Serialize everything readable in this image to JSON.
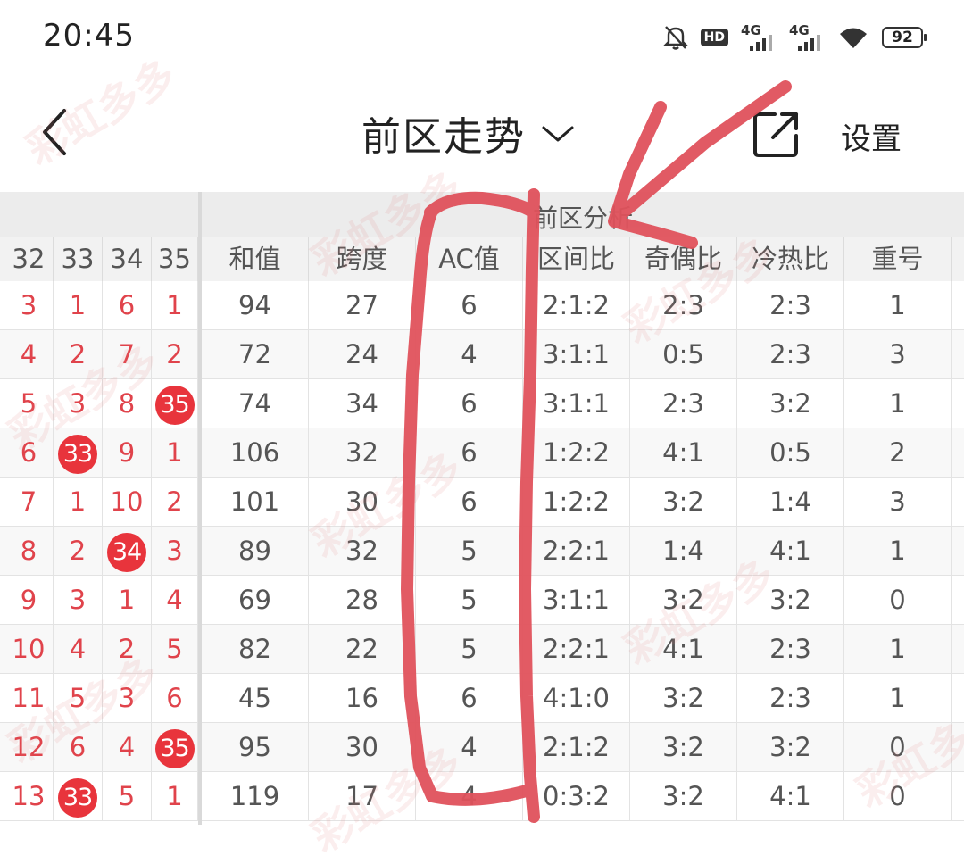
{
  "status_bar": {
    "time": "20:45",
    "hd_label": "HD",
    "sim1_label": "4G",
    "sim2_label": "4G",
    "battery": "92"
  },
  "header": {
    "title": "前区走势",
    "settings_label": "设置"
  },
  "table": {
    "group_title": "前区分析",
    "number_columns": [
      "32",
      "33",
      "34",
      "35"
    ],
    "analysis_columns": [
      "和值",
      "跨度",
      "AC值",
      "区间比",
      "奇偶比",
      "冷热比",
      "重号"
    ],
    "rows": [
      {
        "nums": [
          "3",
          "1",
          "6",
          "1"
        ],
        "hits": [
          false,
          false,
          false,
          false
        ],
        "analysis": [
          "94",
          "27",
          "6",
          "2:1:2",
          "2:3",
          "2:3",
          "1"
        ]
      },
      {
        "nums": [
          "4",
          "2",
          "7",
          "2"
        ],
        "hits": [
          false,
          false,
          false,
          false
        ],
        "analysis": [
          "72",
          "24",
          "4",
          "3:1:1",
          "0:5",
          "2:3",
          "3"
        ]
      },
      {
        "nums": [
          "5",
          "3",
          "8",
          "35"
        ],
        "hits": [
          false,
          false,
          false,
          true
        ],
        "analysis": [
          "74",
          "34",
          "6",
          "3:1:1",
          "2:3",
          "3:2",
          "1"
        ]
      },
      {
        "nums": [
          "6",
          "33",
          "9",
          "1"
        ],
        "hits": [
          false,
          true,
          false,
          false
        ],
        "analysis": [
          "106",
          "32",
          "6",
          "1:2:2",
          "4:1",
          "0:5",
          "2"
        ]
      },
      {
        "nums": [
          "7",
          "1",
          "10",
          "2"
        ],
        "hits": [
          false,
          false,
          false,
          false
        ],
        "analysis": [
          "101",
          "30",
          "6",
          "1:2:2",
          "3:2",
          "1:4",
          "3"
        ]
      },
      {
        "nums": [
          "8",
          "2",
          "34",
          "3"
        ],
        "hits": [
          false,
          false,
          true,
          false
        ],
        "analysis": [
          "89",
          "32",
          "5",
          "2:2:1",
          "1:4",
          "4:1",
          "1"
        ]
      },
      {
        "nums": [
          "9",
          "3",
          "1",
          "4"
        ],
        "hits": [
          false,
          false,
          false,
          false
        ],
        "analysis": [
          "69",
          "28",
          "5",
          "3:1:1",
          "3:2",
          "3:2",
          "0"
        ]
      },
      {
        "nums": [
          "10",
          "4",
          "2",
          "5"
        ],
        "hits": [
          false,
          false,
          false,
          false
        ],
        "analysis": [
          "82",
          "22",
          "5",
          "2:2:1",
          "4:1",
          "2:3",
          "1"
        ]
      },
      {
        "nums": [
          "11",
          "5",
          "3",
          "6"
        ],
        "hits": [
          false,
          false,
          false,
          false
        ],
        "analysis": [
          "45",
          "16",
          "6",
          "4:1:0",
          "3:2",
          "2:3",
          "1"
        ]
      },
      {
        "nums": [
          "12",
          "6",
          "4",
          "35"
        ],
        "hits": [
          false,
          false,
          false,
          true
        ],
        "analysis": [
          "95",
          "30",
          "4",
          "2:1:2",
          "3:2",
          "3:2",
          "0"
        ]
      },
      {
        "nums": [
          "13",
          "33",
          "5",
          "1"
        ],
        "hits": [
          false,
          true,
          false,
          false
        ],
        "analysis": [
          "119",
          "17",
          "4",
          "0:3:2",
          "3:2",
          "4:1",
          "0"
        ]
      }
    ]
  },
  "watermark_text": "彩虹多多",
  "colors": {
    "accent_red": "#e8343c",
    "number_text_red": "#e0434b",
    "annotation_red": "#e0525c"
  }
}
